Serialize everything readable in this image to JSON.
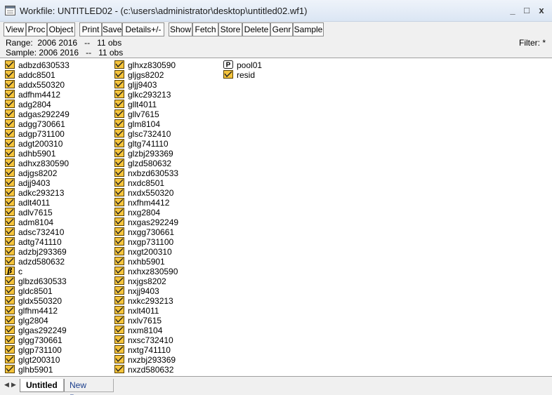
{
  "window": {
    "title": "Workfile: UNTITLED02 - (c:\\users\\administrator\\desktop\\untitled02.wf1)",
    "minimize_symbol": "_",
    "maximize_symbol": "□",
    "close_symbol": "x"
  },
  "toolbar": {
    "buttons": [
      "View",
      "Proc",
      "Object",
      "Print",
      "Save",
      "Details+/-",
      "Show",
      "Fetch",
      "Store",
      "Delete",
      "Genr",
      "Sample"
    ]
  },
  "info": {
    "range": "Range:  2006 2016   --   11 obs",
    "sample": "Sample: 2006 2016   --   11 obs",
    "filter": "Filter: *"
  },
  "objects": {
    "column1": [
      {
        "name": "adbzd630533",
        "type": "series"
      },
      {
        "name": "addc8501",
        "type": "series"
      },
      {
        "name": "addx550320",
        "type": "series"
      },
      {
        "name": "adfhm4412",
        "type": "series"
      },
      {
        "name": "adg2804",
        "type": "series"
      },
      {
        "name": "adgas292249",
        "type": "series"
      },
      {
        "name": "adgg730661",
        "type": "series"
      },
      {
        "name": "adgp731100",
        "type": "series"
      },
      {
        "name": "adgt200310",
        "type": "series"
      },
      {
        "name": "adhb5901",
        "type": "series"
      },
      {
        "name": "adhxz830590",
        "type": "series"
      },
      {
        "name": "adjgs8202",
        "type": "series"
      },
      {
        "name": "adjj9403",
        "type": "series"
      },
      {
        "name": "adkc293213",
        "type": "series"
      },
      {
        "name": "adlt4011",
        "type": "series"
      },
      {
        "name": "adlv7615",
        "type": "series"
      },
      {
        "name": "adm8104",
        "type": "series"
      },
      {
        "name": "adsc732410",
        "type": "series"
      },
      {
        "name": "adtg741110",
        "type": "series"
      },
      {
        "name": "adzbj293369",
        "type": "series"
      },
      {
        "name": "adzd580632",
        "type": "series"
      },
      {
        "name": "c",
        "type": "coef"
      },
      {
        "name": "glbzd630533",
        "type": "series"
      },
      {
        "name": "gldc8501",
        "type": "series"
      },
      {
        "name": "gldx550320",
        "type": "series"
      },
      {
        "name": "glfhm4412",
        "type": "series"
      },
      {
        "name": "glg2804",
        "type": "series"
      },
      {
        "name": "glgas292249",
        "type": "series"
      },
      {
        "name": "glgg730661",
        "type": "series"
      },
      {
        "name": "glgp731100",
        "type": "series"
      },
      {
        "name": "glgt200310",
        "type": "series"
      },
      {
        "name": "glhb5901",
        "type": "series"
      }
    ],
    "column2": [
      {
        "name": "glhxz830590",
        "type": "series"
      },
      {
        "name": "gljgs8202",
        "type": "series"
      },
      {
        "name": "gljj9403",
        "type": "series"
      },
      {
        "name": "glkc293213",
        "type": "series"
      },
      {
        "name": "gllt4011",
        "type": "series"
      },
      {
        "name": "gllv7615",
        "type": "series"
      },
      {
        "name": "glm8104",
        "type": "series"
      },
      {
        "name": "glsc732410",
        "type": "series"
      },
      {
        "name": "gltg741110",
        "type": "series"
      },
      {
        "name": "glzbj293369",
        "type": "series"
      },
      {
        "name": "glzd580632",
        "type": "series"
      },
      {
        "name": "nxbzd630533",
        "type": "series"
      },
      {
        "name": "nxdc8501",
        "type": "series"
      },
      {
        "name": "nxdx550320",
        "type": "series"
      },
      {
        "name": "nxfhm4412",
        "type": "series"
      },
      {
        "name": "nxg2804",
        "type": "series"
      },
      {
        "name": "nxgas292249",
        "type": "series"
      },
      {
        "name": "nxgg730661",
        "type": "series"
      },
      {
        "name": "nxgp731100",
        "type": "series"
      },
      {
        "name": "nxgt200310",
        "type": "series"
      },
      {
        "name": "nxhb5901",
        "type": "series"
      },
      {
        "name": "nxhxz830590",
        "type": "series"
      },
      {
        "name": "nxjgs8202",
        "type": "series"
      },
      {
        "name": "nxjj9403",
        "type": "series"
      },
      {
        "name": "nxkc293213",
        "type": "series"
      },
      {
        "name": "nxlt4011",
        "type": "series"
      },
      {
        "name": "nxlv7615",
        "type": "series"
      },
      {
        "name": "nxm8104",
        "type": "series"
      },
      {
        "name": "nxsc732410",
        "type": "series"
      },
      {
        "name": "nxtg741110",
        "type": "series"
      },
      {
        "name": "nxzbj293369",
        "type": "series"
      },
      {
        "name": "nxzd580632",
        "type": "series"
      }
    ],
    "column3": [
      {
        "name": "pool01",
        "type": "pool"
      },
      {
        "name": "resid",
        "type": "series"
      }
    ]
  },
  "tabs": {
    "active": "Untitled",
    "new_page": "New Page"
  },
  "colors": {
    "series_icon_fill": "#f5c43c",
    "series_icon_border": "#5a4200",
    "titlebar": "#dbe6f4",
    "panel_bg": "#f0f0f0"
  },
  "icons": {
    "series": "series-icon",
    "coef": "beta-coef-icon",
    "pool": "pool-p-icon",
    "app": "workfile-icon",
    "tab_left": "triangle-left-icon",
    "tab_right": "triangle-right-icon"
  }
}
